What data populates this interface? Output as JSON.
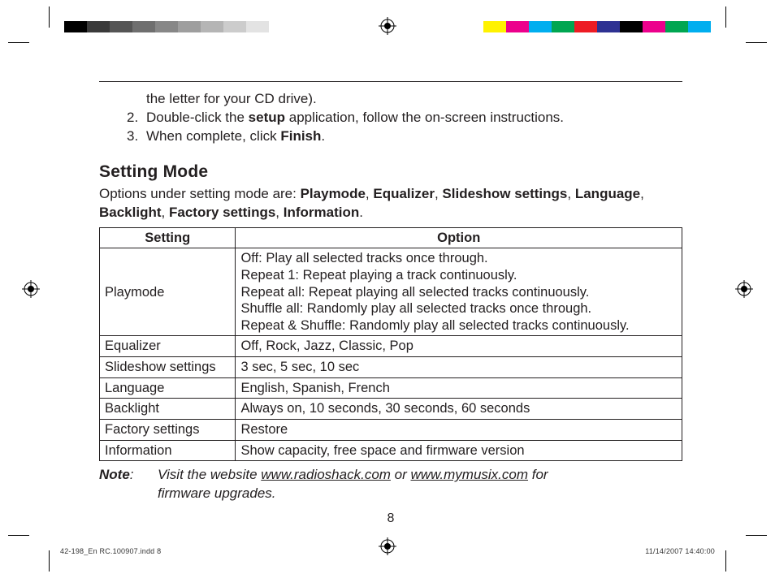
{
  "swatch_gray": [
    "#000000",
    "#3a3a3a",
    "#555555",
    "#6f6f6f",
    "#878787",
    "#9e9e9e",
    "#b5b5b5",
    "#cccccc",
    "#e3e3e3",
    "#ffffff"
  ],
  "swatch_color": [
    "#fff200",
    "#ec008c",
    "#00aeef",
    "#00a651",
    "#ed1c24",
    "#2e3192",
    "#000000",
    "#ec008c",
    "#00a651",
    "#00aeef"
  ],
  "instructions": {
    "line1_indent": "the letter for your CD drive).",
    "line2_num": "2.",
    "line2_a": "Double-click the ",
    "line2_b_bold": "setup",
    "line2_c": " application, follow the on-screen instructions.",
    "line3_num": "3.",
    "line3_a": "When complete, click ",
    "line3_b_bold": "Finish",
    "line3_c": "."
  },
  "heading": "Setting Mode",
  "intro": {
    "a": "Options under setting mode are: ",
    "items": [
      "Playmode",
      "Equalizer",
      "Slideshow settings",
      "Language",
      "Backlight",
      "Factory settings",
      "Information"
    ],
    "sep": ", ",
    "end": "."
  },
  "table": {
    "head_setting": "Setting",
    "head_option": "Option",
    "rows": [
      {
        "setting": "Playmode",
        "option_lines": [
          "Off: Play all selected tracks once through.",
          "Repeat 1: Repeat playing a track continuously.",
          "Repeat all: Repeat playing all selected tracks continuously.",
          "Shuffle all: Randomly play all selected tracks once through.",
          "Repeat & Shuffle: Randomly play all selected tracks continuously."
        ]
      },
      {
        "setting": "Equalizer",
        "option_lines": [
          "Off, Rock, Jazz, Classic, Pop"
        ]
      },
      {
        "setting": "Slideshow settings",
        "option_lines": [
          "3 sec, 5 sec, 10 sec"
        ]
      },
      {
        "setting": "Language",
        "option_lines": [
          "English, Spanish, French"
        ]
      },
      {
        "setting": "Backlight",
        "option_lines": [
          "Always on, 10 seconds, 30 seconds, 60 seconds"
        ]
      },
      {
        "setting": "Factory settings",
        "option_lines": [
          "Restore"
        ]
      },
      {
        "setting": "Information",
        "option_lines": [
          "Show capacity, free space and firmware version"
        ]
      }
    ]
  },
  "note": {
    "label": "Note",
    "colon": ":",
    "a": "Visit the website ",
    "link1": "www.radioshack.com",
    "b": " or ",
    "link2": "www.mymusix.com",
    "c": " for ",
    "d": "firmware upgrades."
  },
  "pagenum": "8",
  "footer": {
    "filename": "42-198_En RC.100907.indd   8",
    "datetime": "11/14/2007   14:40:00"
  }
}
